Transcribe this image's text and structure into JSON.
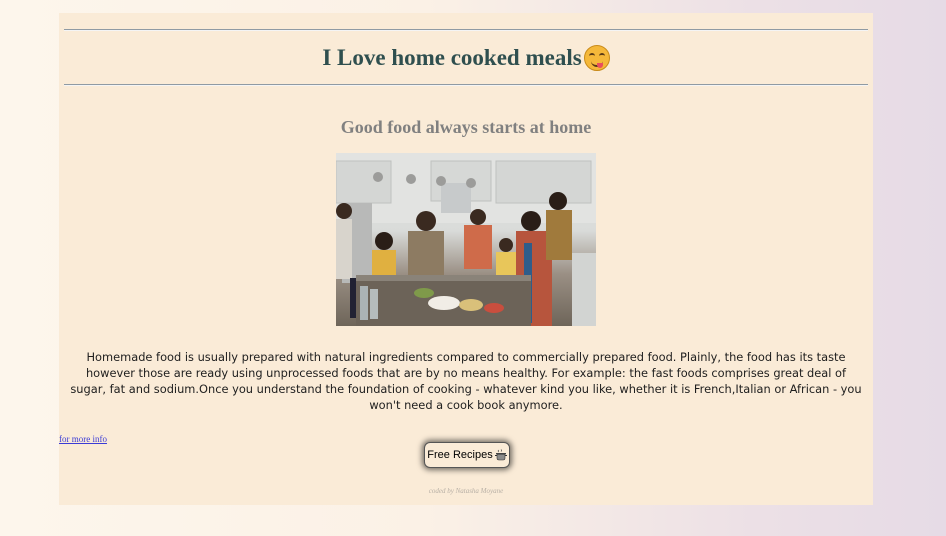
{
  "header": {
    "title": "I Love home cooked meals",
    "title_emoji": "face-savoring-food-icon"
  },
  "subtitle": "Good food always starts at home",
  "image": {
    "subject": "family cooking together in kitchen"
  },
  "paragraph": "Homemade food is usually prepared with natural ingredients compared to commercially prepared food. Plainly, the food has its taste however those are ready using unprocessed foods that are by no means healthy. For example: the fast foods comprises great deal of sugar, fat and sodium.Once you understand the foundation of cooking - whatever kind you like, whether it is French,Italian or African - you won't need a cook book anymore.",
  "link": {
    "label": "for more info"
  },
  "button": {
    "label": "Free Recipes",
    "icon": "cooking-pot-icon"
  },
  "footer": {
    "credit": "coded by Natasha Moyane"
  },
  "colors": {
    "card_bg": "#faebd7",
    "title": "#2f4f4f",
    "subtitle": "#808080",
    "link": "#3b3bd6"
  }
}
